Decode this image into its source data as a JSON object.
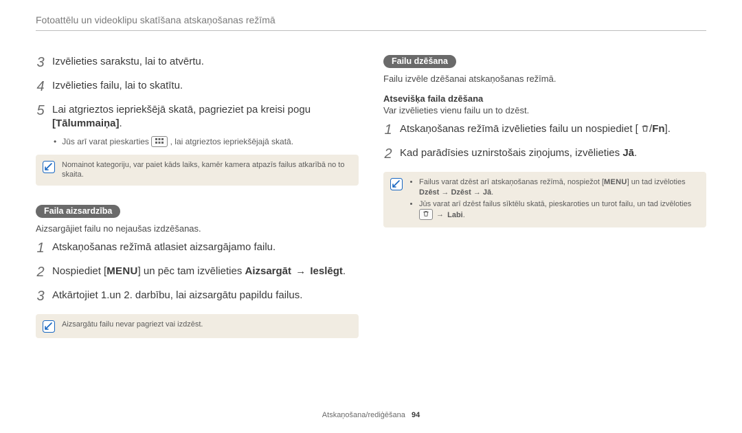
{
  "header": {
    "title": "Fotoattēlu un videoklipu skatīšana atskaņošanas režīmā"
  },
  "left": {
    "steps_a": [
      {
        "n": "3",
        "text": "Izvēlieties sarakstu, lai to atvērtu."
      },
      {
        "n": "4",
        "text": "Izvēlieties failu, lai to skatītu."
      }
    ],
    "step5": {
      "n": "5",
      "text_a": "Lai atgrieztos iepriekšējā skatā, pagrieziet pa kreisi pogu ",
      "bracket": "[Tālummaiņa]",
      "text_b": "."
    },
    "sub_bullet": {
      "pre": "Jūs arī varat pieskarties ",
      "post": ", lai atgrieztos iepriekšējajā skatā."
    },
    "note1": "Nomainot kategoriju, var paiet kāds laiks, kamēr kamera atpazīs failus atkarībā no to skaita.",
    "tag": "Faila aizsardzība",
    "tag_intro": "Aizsargājiet failu no nejaušas izdzēšanas.",
    "steps_b": {
      "s1": {
        "n": "1",
        "text": "Atskaņošanas režīmā atlasiet aizsargājamo failu."
      },
      "s2": {
        "n": "2",
        "pre": "Nospiediet [",
        "menu": "MENU",
        "mid": "] un pēc tam izvēlieties ",
        "bold1": "Aizsargāt",
        "arrow": " → ",
        "bold2": "Ieslēgt",
        "post": "."
      },
      "s3": {
        "n": "3",
        "text": "Atkārtojiet 1.un 2. darbību, lai aizsargātu papildu failus."
      }
    },
    "note2": "Aizsargātu failu nevar pagriezt vai izdzēst."
  },
  "right": {
    "tag": "Failu dzēšana",
    "tag_intro": "Failu izvēle dzēšanai atskaņošanas režīmā.",
    "sub_heading": "Atsevišķa faila dzēšana",
    "sub_intro": "Var izvēlieties vienu failu un to dzēst.",
    "steps": {
      "s1": {
        "n": "1",
        "pre": "Atskaņošanas režīmā izvēlieties failu un nospiediet [",
        "fn": "Fn",
        "post": "]."
      },
      "s2": {
        "n": "2",
        "pre": "Kad parādīsies uznirstošais ziņojums, izvēlieties ",
        "bold": "Jā",
        "post": "."
      }
    },
    "note": {
      "li1_pre": "Failus varat dzēst arī atskaņošanas režīmā, nospiežot [",
      "li1_menu": "MENU",
      "li1_post": "] un tad izvēloties ",
      "li1_chain": "Dzēst → Dzēst → Jā",
      "li1_end": ".",
      "li2_pre": "Jūs varat arī dzēst failus sīktēlu skatā, pieskaroties un turot failu, un tad izvēloties ",
      "li2_arrow": " → ",
      "li2_bold": "Labi",
      "li2_end": "."
    }
  },
  "footer": {
    "section": "Atskaņošana/rediģēšana",
    "page": "94"
  }
}
